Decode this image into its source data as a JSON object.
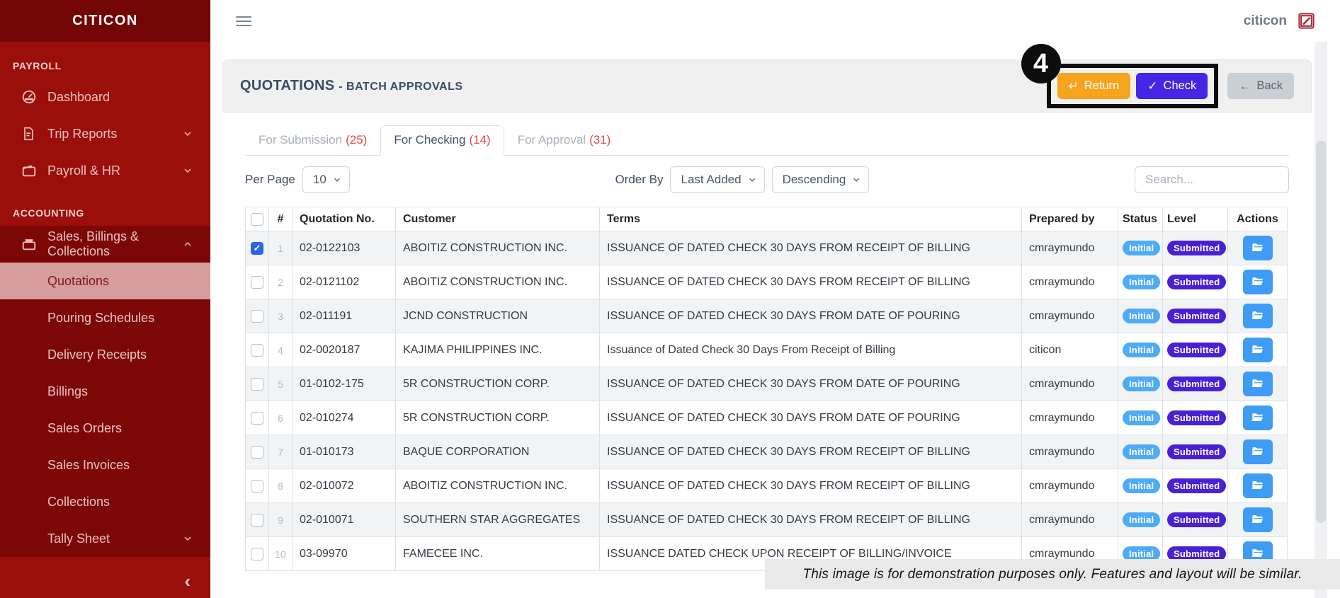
{
  "sidebar": {
    "brand": "CITICON",
    "payroll_label": "PAYROLL",
    "payroll_items": [
      {
        "label": "Dashboard",
        "icon": "dashboard-icon"
      },
      {
        "label": "Trip Reports",
        "icon": "document-icon",
        "chevron": "down"
      },
      {
        "label": "Payroll & HR",
        "icon": "wallet-icon",
        "chevron": "down"
      }
    ],
    "accounting_label": "ACCOUNTING",
    "accounting_parent": {
      "label": "Sales, Billings & Collections",
      "icon": "briefcase-icon",
      "chevron": "up",
      "expanded": true
    },
    "accounting_children": [
      {
        "label": "Quotations",
        "active": true
      },
      {
        "label": "Pouring Schedules"
      },
      {
        "label": "Delivery Receipts"
      },
      {
        "label": "Billings"
      },
      {
        "label": "Sales Orders"
      },
      {
        "label": "Sales Invoices"
      },
      {
        "label": "Collections"
      },
      {
        "label": "Tally Sheet",
        "chevron": true
      }
    ]
  },
  "navbar": {
    "user": "citicon"
  },
  "header": {
    "title": "QUOTATIONS",
    "subtitle": "- BATCH APPROVALS",
    "annotation_number": "4",
    "return_label": "Return",
    "return_icon": "↵",
    "check_label": "Check",
    "check_icon": "✓",
    "back_label": "Back",
    "back_icon": "←"
  },
  "tabs": [
    {
      "label": "For Submission",
      "count": "(25)",
      "active": false
    },
    {
      "label": "For Checking",
      "count": "(14)",
      "active": true
    },
    {
      "label": "For Approval",
      "count": "(31)",
      "active": false
    }
  ],
  "controls": {
    "per_page_label": "Per Page",
    "per_page_value": "10",
    "order_by_label": "Order By",
    "order_field_value": "Last Added",
    "order_direction_value": "Descending",
    "search_placeholder": "Search..."
  },
  "table": {
    "headers": [
      "#",
      "Quotation No.",
      "Customer",
      "Terms",
      "Prepared by",
      "Status",
      "Level",
      "Actions"
    ],
    "rows": [
      {
        "num": "1",
        "quotation_no": "02-0122103",
        "customer": "ABOITIZ CONSTRUCTION INC.",
        "terms": "ISSUANCE OF DATED CHECK 30 DAYS FROM RECEIPT OF BILLING",
        "prepared_by": "cmraymundo",
        "status": "Initial",
        "level": "Submitted",
        "checked": true
      },
      {
        "num": "2",
        "quotation_no": "02-0121102",
        "customer": "ABOITIZ CONSTRUCTION INC.",
        "terms": "ISSUANCE OF DATED CHECK 30 DAYS FROM RECEIPT OF BILLING",
        "prepared_by": "cmraymundo",
        "status": "Initial",
        "level": "Submitted"
      },
      {
        "num": "3",
        "quotation_no": "02-011191",
        "customer": "JCND CONSTRUCTION",
        "terms": "ISSUANCE OF DATED CHECK 30 DAYS FROM DATE OF POURING",
        "prepared_by": "cmraymundo",
        "status": "Initial",
        "level": "Submitted"
      },
      {
        "num": "4",
        "quotation_no": "02-0020187",
        "customer": "KAJIMA PHILIPPINES INC.",
        "terms": "Issuance of Dated Check 30 Days From Receipt of Billing",
        "prepared_by": "citicon",
        "status": "Initial",
        "level": "Submitted"
      },
      {
        "num": "5",
        "quotation_no": "01-0102-175",
        "customer": "5R CONSTRUCTION CORP.",
        "terms": "ISSUANCE OF DATED CHECK 30 DAYS FROM DATE OF POURING",
        "prepared_by": "cmraymundo",
        "status": "Initial",
        "level": "Submitted"
      },
      {
        "num": "6",
        "quotation_no": "02-010274",
        "customer": "5R CONSTRUCTION CORP.",
        "terms": "ISSUANCE OF DATED CHECK 30 DAYS FROM DATE OF POURING",
        "prepared_by": "cmraymundo",
        "status": "Initial",
        "level": "Submitted"
      },
      {
        "num": "7",
        "quotation_no": "01-010173",
        "customer": "BAQUE CORPORATION",
        "terms": "ISSUANCE OF DATED CHECK 30 DAYS FROM RECEIPT OF BILLING",
        "prepared_by": "cmraymundo",
        "status": "Initial",
        "level": "Submitted"
      },
      {
        "num": "8",
        "quotation_no": "02-010072",
        "customer": "ABOITIZ CONSTRUCTION INC.",
        "terms": "ISSUANCE OF DATED CHECK 30 DAYS FROM RECEIPT OF BILLING",
        "prepared_by": "cmraymundo",
        "status": "Initial",
        "level": "Submitted"
      },
      {
        "num": "9",
        "quotation_no": "02-010071",
        "customer": "SOUTHERN STAR AGGREGATES",
        "terms": "ISSUANCE OF DATED CHECK 30 DAYS FROM RECEIPT OF BILLING",
        "prepared_by": "cmraymundo",
        "status": "Initial",
        "level": "Submitted"
      },
      {
        "num": "10",
        "quotation_no": "03-09970",
        "customer": "FAMECEE INC.",
        "terms": "ISSUANCE DATED CHECK UPON RECEIPT OF BILLING/INVOICE",
        "prepared_by": "cmraymundo",
        "status": "Initial",
        "level": "Submitted"
      }
    ]
  },
  "footer": {
    "disclaimer": "This image is for demonstration purposes only. Features and layout will be similar."
  },
  "colors": {
    "sidebar_red": "#9b0f0a",
    "sidebar_header_red": "#740505",
    "sidebar_submenu_red": "#7c0707",
    "active_item_pink": "#d79c9c",
    "return_yellow": "#f7a41d",
    "check_indigo": "#4526e4",
    "back_gray": "#cacfd5",
    "badge_initial_blue": "#4fabf6",
    "badge_submitted_indigo": "#4a20d5",
    "action_blue": "#3e9cf5",
    "count_red": "#e64545",
    "annotation_black": "#0d0d0d"
  }
}
